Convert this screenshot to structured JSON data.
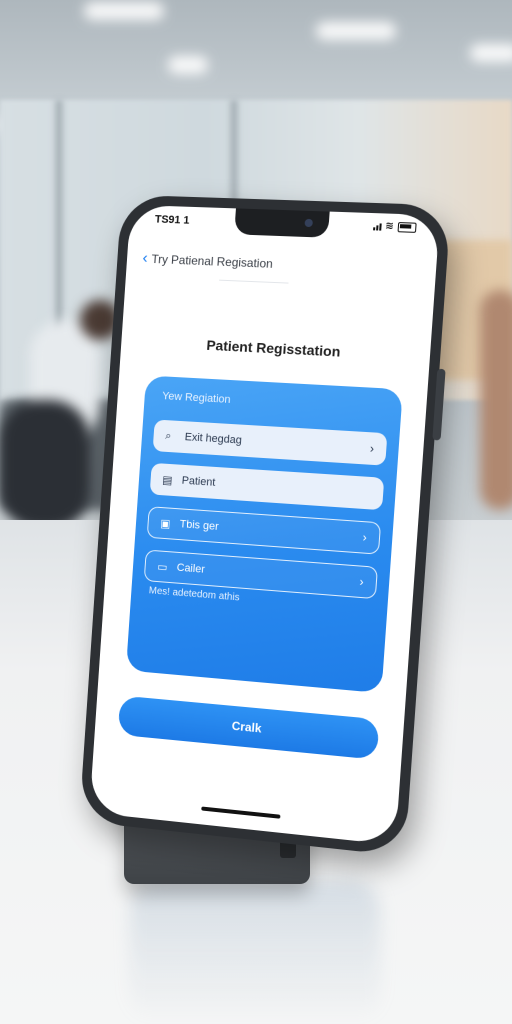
{
  "status_bar": {
    "time": "TS91 1"
  },
  "nav": {
    "back_label": "Try Patienal Regisation"
  },
  "page_title": "Patient Regisstation",
  "card": {
    "header": "Yew Regiation",
    "rows": [
      {
        "icon": "search-icon",
        "label": "Exit hegdag",
        "style": "solid",
        "chevron": true
      },
      {
        "icon": "document-icon",
        "label": "Patient",
        "style": "solid",
        "chevron": false
      },
      {
        "icon": "lock-icon",
        "label": "Tbis ger",
        "style": "outline",
        "chevron": true
      },
      {
        "icon": "card-icon",
        "label": "Cailer",
        "style": "outline",
        "chevron": true
      }
    ],
    "footer_text": "Mes! adetedom athis"
  },
  "primary_button": {
    "label": "Cralk"
  },
  "colors": {
    "accent": "#1d7ae6",
    "card_gradient_start": "#4aa5f6",
    "card_gradient_end": "#1f7de8"
  }
}
